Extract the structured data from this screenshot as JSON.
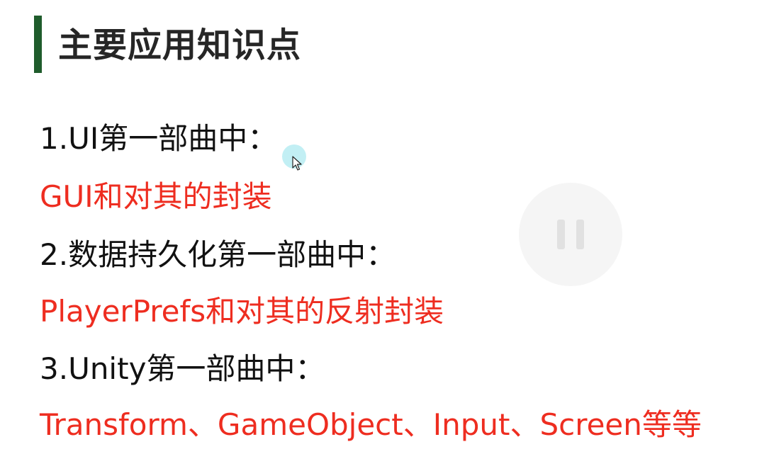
{
  "slide": {
    "title": "主要应用知识点",
    "items": [
      {
        "heading": "1.UI第一部曲中：",
        "detail": "GUI和对其的封装"
      },
      {
        "heading": "2.数据持久化第一部曲中：",
        "detail": "PlayerPrefs和对其的反射封装"
      },
      {
        "heading": "3.Unity第一部曲中：",
        "detail": "Transform、GameObject、Input、Screen等等"
      }
    ]
  },
  "colors": {
    "accent_bar": "#1f5c2c",
    "title_text": "#262626",
    "heading_text": "#111111",
    "detail_text": "#ee2d20"
  },
  "icons": {
    "cursor": "mouse-cursor-icon",
    "pause": "pause-icon"
  }
}
